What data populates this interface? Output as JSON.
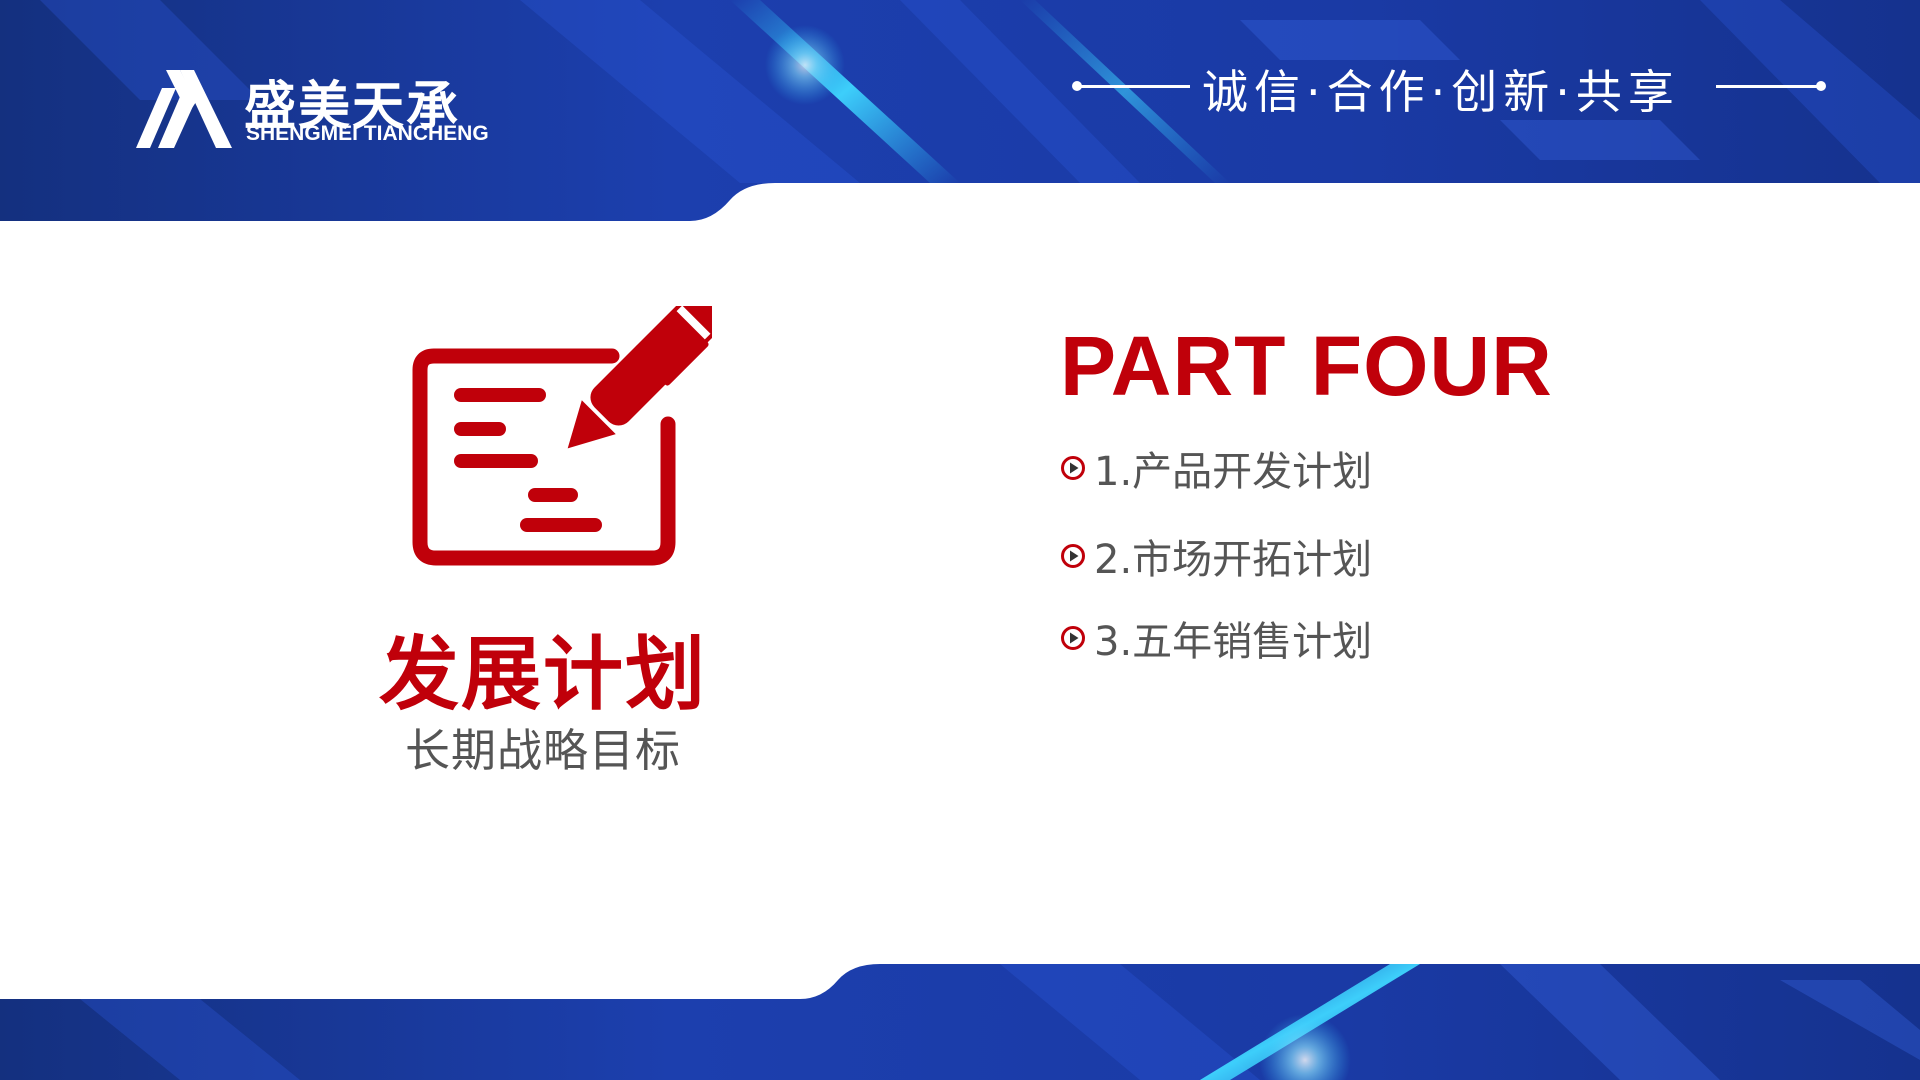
{
  "brand": {
    "name_cn": "盛美天承",
    "name_en": "SHENGMEI TIANCHENG"
  },
  "slogan": "诚信·合作·创新·共享",
  "section": {
    "title": "发展计划",
    "subtitle": "长期战略目标",
    "icon": "plan-edit-icon"
  },
  "part": {
    "title": "PART FOUR",
    "items": [
      {
        "label": "1.产品开发计划"
      },
      {
        "label": "2.市场开拓计划"
      },
      {
        "label": "3.五年销售计划"
      }
    ]
  },
  "colors": {
    "accent_red": "#c0000a",
    "banner_blue": "#1a3fb0",
    "highlight_cyan": "#2ec5ff",
    "text_gray": "#555555"
  }
}
